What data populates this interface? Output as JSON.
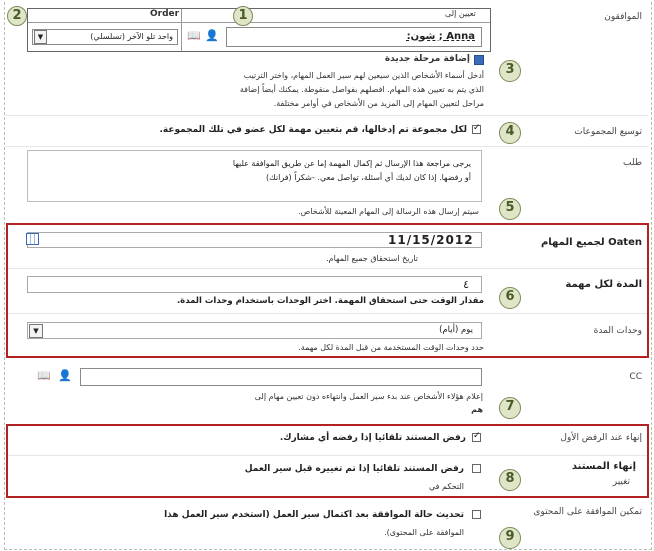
{
  "approvers": {
    "label": "الموافقون",
    "assign_header": "تعيين إلى",
    "order_header": "Order",
    "assignee_value": "Anna ; شون:",
    "order_value": "واحد تلو الآخر (تسلسلي)",
    "add_stage_label": "إضافة مرحلة جديدة",
    "help_line1": "أدخل أسماء الأشخاص الذين سيعين لهم سير العمل المهام، واختر الترتيب",
    "help_line2": "الذي يتم به تعيين هذه المهام. افصلهم بفواصل منقوطة. يمكنك أيضاً إضافة",
    "help_line3": "مراحل لتعيين المهام إلى المزيد من الأشخاص في أوامر مختلفة."
  },
  "expand_groups": {
    "label": "توسيع المجموعات",
    "checkbox_text": "لكل مجموعة تم إدخالها، قم بتعيين مهمة لكل عضو في تلك المجموعة."
  },
  "request": {
    "label": "طلب",
    "line1": "يرجى مراجعة هذا الإرسال ثم إكمال المهمة إما عن طريق الموافقة عليها",
    "line2": "أو رفضها. إذا كان لديك أي أسئلة، تواصل معي. -شكراً (فرانك)",
    "hint": "سيتم إرسال هذه الرسالة إلى المهام المعينة للأشخاص."
  },
  "due_date": {
    "label": "Oaten لجميع المهام",
    "value": "11/15/2012",
    "hint": "تاريخ استحقاق جميع المهام."
  },
  "duration": {
    "label": "المدة لكل مهمة",
    "value": "٤",
    "hint": "مقدار الوقت حتى استحقاق المهمة. اختر الوحدات باستخدام وحدات المدة."
  },
  "duration_units": {
    "label": "وحدات المدة",
    "value": "يوم (أيام)",
    "hint": "حدد وحدات الوقت المستخدمة من قبل المدة لكل مهمة."
  },
  "cc": {
    "label": "CC",
    "hint1": "إعلام هؤلاء الأشخاص عند بدء سير العمل وانتهاءه دون تعيين مهام إلى",
    "hint2": "هم"
  },
  "end_first_reject": {
    "label": "إنهاء عند الرفض الأول",
    "checkbox_text": "رفض المستند تلقائيا إذا رفضه أي مشارك."
  },
  "end_on_change": {
    "label1": "إنهاء المستند",
    "label2": "تغيير",
    "checkbox_text": "رفض المستند تلقائيا إذا تم تغييره قبل سير العمل",
    "hint": "التحكم في"
  },
  "content_approval": {
    "label": "تمكين الموافقة على المحتوى",
    "checkbox_text": "تحديث حالة الموافقة بعد اكتمال سير العمل (استخدم سير العمل هذا",
    "hint": "الموافقة على المحتوى)."
  },
  "callouts": [
    "1",
    "2",
    "3",
    "4",
    "5",
    "6",
    "7",
    "8",
    "9"
  ],
  "colors": {
    "callout_bg": "#dfe6c8",
    "callout_border": "#7d8a5a",
    "highlight_box": "#b22222"
  }
}
